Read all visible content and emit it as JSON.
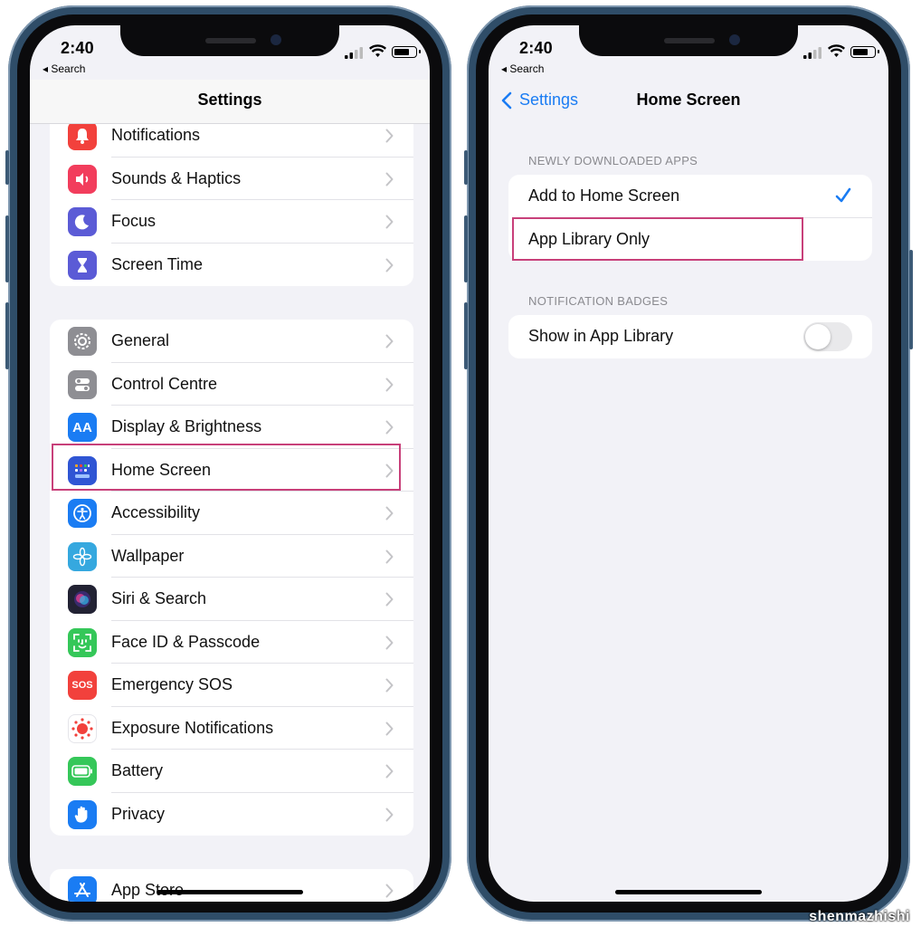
{
  "status": {
    "time": "2:40",
    "back_app": "◂ Search"
  },
  "left": {
    "title": "Settings",
    "group1": [
      {
        "label": "Notifications",
        "icon": "bell-icon",
        "color": "#f2413c"
      },
      {
        "label": "Sounds & Haptics",
        "icon": "speaker-icon",
        "color": "#f23d5c"
      },
      {
        "label": "Focus",
        "icon": "moon-icon",
        "color": "#5b5bd6"
      },
      {
        "label": "Screen Time",
        "icon": "hourglass-icon",
        "color": "#5b5bd6"
      }
    ],
    "group2": [
      {
        "label": "General",
        "icon": "gear-icon",
        "color": "#8e8e93"
      },
      {
        "label": "Control Centre",
        "icon": "toggles-icon",
        "color": "#8e8e93"
      },
      {
        "label": "Display & Brightness",
        "icon": "text-size-icon",
        "color": "#1a7cf3",
        "glyph": "AA"
      },
      {
        "label": "Home Screen",
        "icon": "home-grid-icon",
        "color": "#2f55d4"
      },
      {
        "label": "Accessibility",
        "icon": "accessibility-icon",
        "color": "#1a7cf3"
      },
      {
        "label": "Wallpaper",
        "icon": "flower-icon",
        "color": "#35a8df"
      },
      {
        "label": "Siri & Search",
        "icon": "siri-icon",
        "color": "#222233"
      },
      {
        "label": "Face ID & Passcode",
        "icon": "face-id-icon",
        "color": "#35c759"
      },
      {
        "label": "Emergency SOS",
        "icon": "sos-icon",
        "color": "#f2413c",
        "glyph": "SOS"
      },
      {
        "label": "Exposure Notifications",
        "icon": "exposure-icon",
        "color": "#ffffff"
      },
      {
        "label": "Battery",
        "icon": "battery-icon",
        "color": "#35c759"
      },
      {
        "label": "Privacy",
        "icon": "hand-icon",
        "color": "#1a7cf3"
      }
    ],
    "group3": [
      {
        "label": "App Store",
        "icon": "app-store-icon",
        "color": "#1a7cf3"
      }
    ]
  },
  "right": {
    "back_label": "Settings",
    "title": "Home Screen",
    "section1_header": "NEWLY DOWNLOADED APPS",
    "option1": "Add to Home Screen",
    "option2": "App Library Only",
    "section2_header": "NOTIFICATION BADGES",
    "toggle_label": "Show in App Library",
    "toggle_on": false,
    "selected_option": "Add to Home Screen"
  },
  "watermark": "shenmazhishi",
  "colors": {
    "accent": "#1a7cf3",
    "highlight": "#c8407a"
  }
}
